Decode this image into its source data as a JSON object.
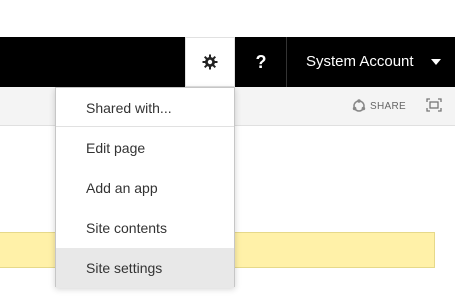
{
  "topbar": {
    "gear_icon": "gear-icon",
    "help_label": "?",
    "account_name": "System Account",
    "account_caret_icon": "caret-down-icon"
  },
  "ribbon": {
    "share_label": "SHARE",
    "share_icon": "share-icon",
    "focus_icon": "focus-on-content-icon"
  },
  "settings_menu": {
    "items": [
      {
        "label": "Shared with..."
      },
      {
        "label": "Edit page"
      },
      {
        "label": "Add an app"
      },
      {
        "label": "Site contents"
      },
      {
        "label": "Site settings"
      }
    ],
    "highlighted_item": "Site settings"
  },
  "colors": {
    "topbar_bg": "#000000",
    "notice_bg": "#fff1a8",
    "menu_hover_bg": "#e8e8e8"
  }
}
